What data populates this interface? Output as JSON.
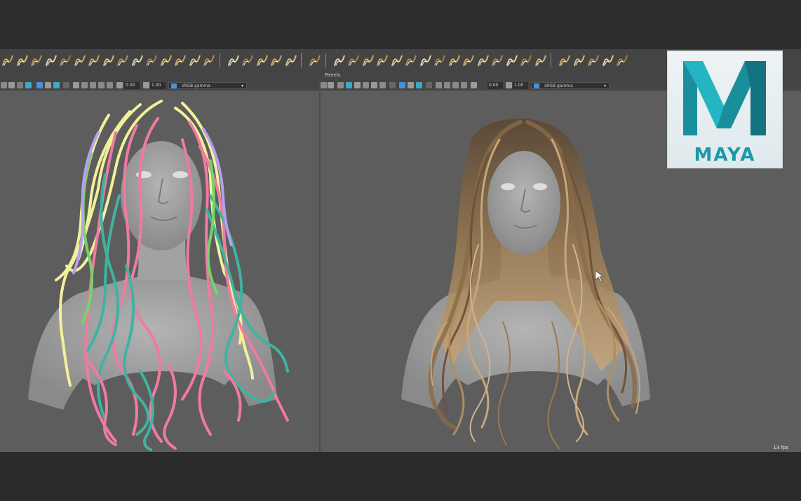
{
  "app": {
    "name": "Maya"
  },
  "panels_label": "Panels",
  "left_viewport": {
    "exposure": "0.00",
    "gamma": "1.00",
    "color_space": "sRGB gamma"
  },
  "right_viewport": {
    "exposure": "0.00",
    "gamma": "1.00",
    "color_space": "sRGB gamma",
    "fps": "13 fps"
  },
  "logo": {
    "text": "MAYA"
  },
  "colors": {
    "viewport_bg": "#5d5d5d",
    "shelf_bg": "#444444",
    "guide_yellow": "#f2f19a",
    "guide_pink": "#f07aa0",
    "guide_teal": "#3fb3a2",
    "guide_green": "#74d36a",
    "guide_lavender": "#b89ef0",
    "hair_brown": "#8a6a45",
    "logo_teal": "#1a9aa8"
  },
  "shelf_icons": [
    "curve-brush-icon",
    "hair-clump-icon",
    "hair-scale-icon",
    "hair-frizz-icon",
    "hair-twist-icon",
    "hair-length-icon",
    "hair-comb-icon",
    "hair-kink-icon",
    "hair-direction-icon",
    "hair-grow-icon",
    "hair-cut-icon",
    "hair-flip-icon",
    "hair-mirror-icon",
    "hair-smooth-icon",
    "hair-select-icon",
    "sphere-icon",
    "light-icon",
    "sculpt-icon",
    "transfer-icon",
    "paint-icon",
    "move-tool-icon",
    "record-icon",
    "clump-modifier-icon",
    "scale-modifier-icon",
    "frizz-modifier-icon",
    "coil-modifier-icon",
    "cut-modifier-icon",
    "length-modifier-icon",
    "attract-modifier-icon",
    "displace-modifier-icon",
    "noise-modifier-icon",
    "sub-modifier-icon",
    "flag-icon",
    "flip-icon",
    "bend-icon",
    "width-icon",
    "cube-icon",
    "render-sphere-icon",
    "brush-icon",
    "export-icon",
    "import-icon"
  ]
}
